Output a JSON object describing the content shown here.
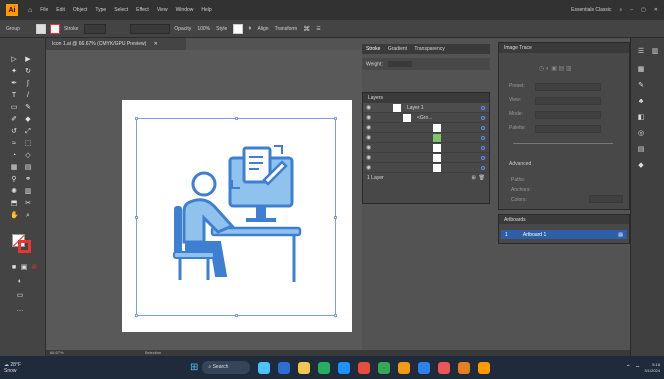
{
  "app": {
    "logo": "Ai",
    "menu": [
      "File",
      "Edit",
      "Object",
      "Type",
      "Select",
      "Effect",
      "View",
      "Window",
      "Help"
    ],
    "workspace": "Essentials Classic"
  },
  "control_bar": {
    "left_label": "Group",
    "stroke_label": "Stroke",
    "opacity_label": "Opacity",
    "opacity_value": "100%",
    "style_label": "Style",
    "align_label": "Align",
    "transform_label": "Transform"
  },
  "document_tab": "Icon 1.ai @ 66.67% (CMYK/GPU Preview)",
  "stroke_panel": {
    "tabs": [
      "Stroke",
      "Gradient",
      "Transparency"
    ],
    "weight_label": "Weight:"
  },
  "layers_panel": {
    "title": "Layers",
    "rows": [
      "Layer 1",
      "<Gro...",
      "",
      "",
      "",
      "",
      "",
      ""
    ],
    "footer": "1 Layer"
  },
  "properties_panel": {
    "title": "Image Trace",
    "labels": [
      "Preset:",
      "View:",
      "Mode:",
      "Palette:",
      "Advanced",
      "Paths:",
      "Anchors:",
      "Colors:"
    ]
  },
  "artboards_panel": {
    "title": "Artboards",
    "row_index": "1",
    "row_name": "Artboard 1"
  },
  "status": {
    "zoom": "66.67%",
    "mode": "Selection"
  },
  "taskbar": {
    "weather_temp": "28°F",
    "weather_desc": "Snow",
    "search_label": "Search",
    "icon_colors": [
      "#4cc2ff",
      "#2b6fd6",
      "#f2c94c",
      "#27ae60",
      "#1e90ff",
      "#e74c3c",
      "#34a853",
      "#f39c12",
      "#2f80ed",
      "#eb5757",
      "#e67e22",
      "#ff9a00"
    ],
    "time": "5:18",
    "date": "3/1/2024"
  },
  "colors": {
    "accent": "#2c5fa8",
    "illustration_blue": "#3e7fd1",
    "illustration_light": "#8fc3ee",
    "selection": "#7f9ce8"
  }
}
